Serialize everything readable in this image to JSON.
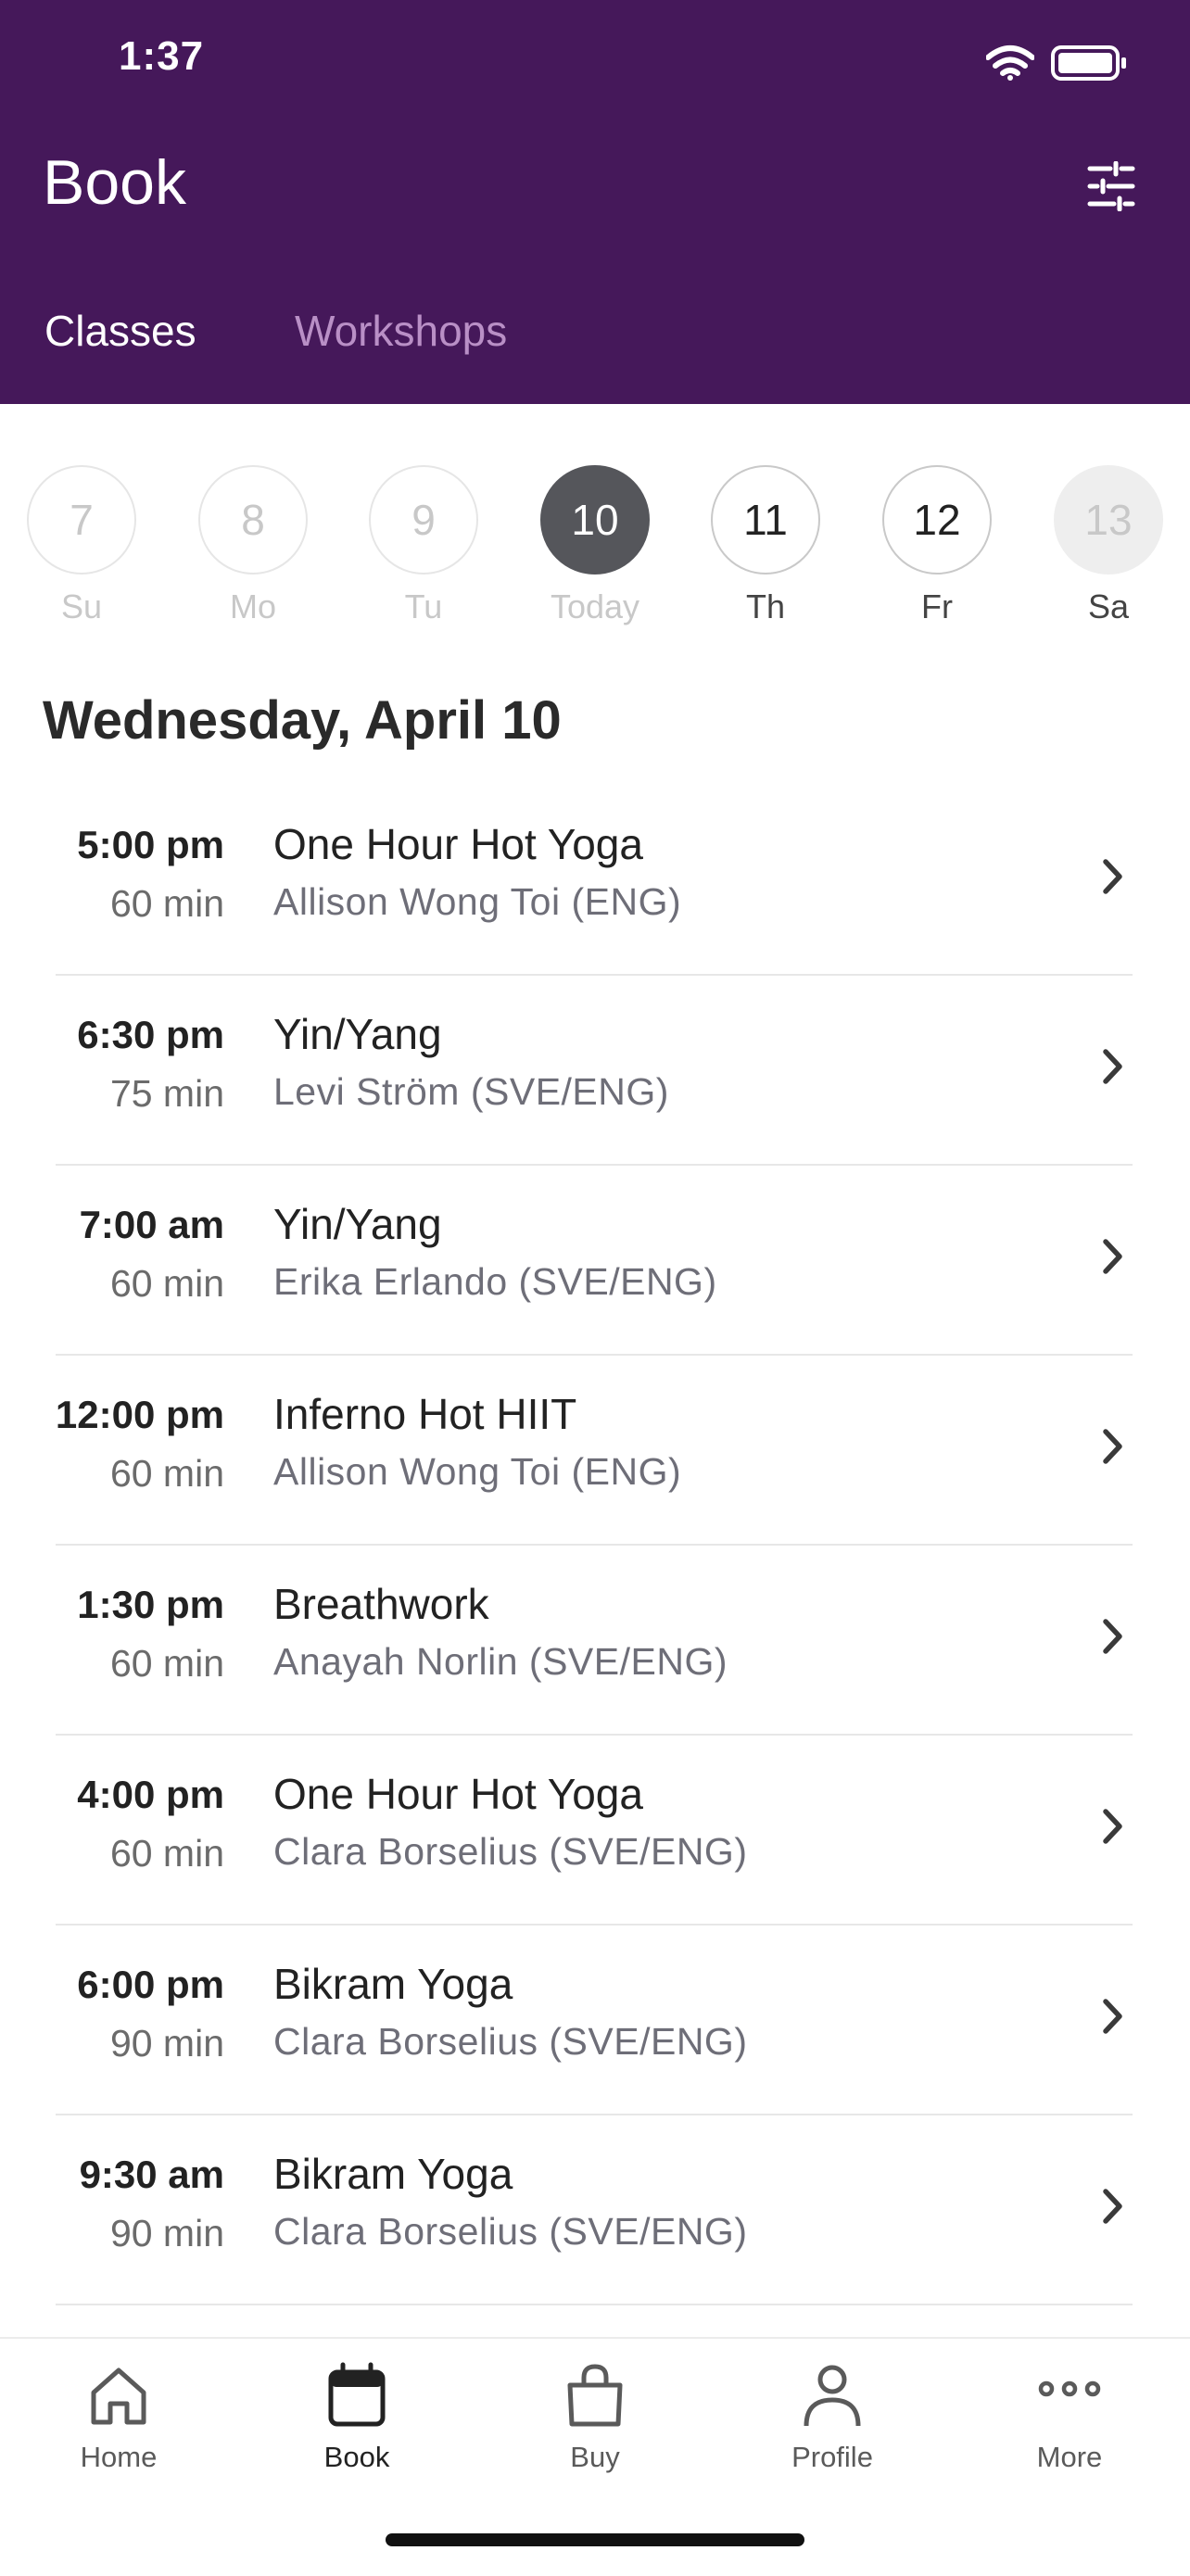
{
  "status_bar": {
    "time": "1:37"
  },
  "header": {
    "title": "Book",
    "filter_icon": "sliders-icon",
    "tabs": [
      {
        "label": "Classes",
        "active": true
      },
      {
        "label": "Workshops",
        "active": false
      }
    ]
  },
  "colors": {
    "header_bg": "#45185a",
    "selected_day": "#55565b",
    "inactive_tab": "#b98fc6"
  },
  "days": [
    {
      "number": "7",
      "label": "Su",
      "state": "past"
    },
    {
      "number": "8",
      "label": "Mo",
      "state": "past"
    },
    {
      "number": "9",
      "label": "Tu",
      "state": "past"
    },
    {
      "number": "10",
      "label": "Today",
      "state": "selected"
    },
    {
      "number": "11",
      "label": "Th",
      "state": "future"
    },
    {
      "number": "12",
      "label": "Fr",
      "state": "future"
    },
    {
      "number": "13",
      "label": "Sa",
      "state": "unavailable"
    }
  ],
  "date_heading": "Wednesday, April 10",
  "classes": [
    {
      "time": "5:00 pm",
      "duration": "60 min",
      "name": "One Hour Hot Yoga",
      "instructor": "Allison Wong Toi (ENG)"
    },
    {
      "time": "6:30 pm",
      "duration": "75 min",
      "name": "Yin/Yang",
      "instructor": "Levi Ström (SVE/ENG)"
    },
    {
      "time": "7:00 am",
      "duration": "60 min",
      "name": "Yin/Yang",
      "instructor": "Erika Erlando (SVE/ENG)"
    },
    {
      "time": "12:00 pm",
      "duration": "60 min",
      "name": "Inferno Hot HIIT",
      "instructor": "Allison Wong Toi (ENG)"
    },
    {
      "time": "1:30 pm",
      "duration": "60 min",
      "name": "Breathwork",
      "instructor": "Anayah Norlin (SVE/ENG)"
    },
    {
      "time": "4:00 pm",
      "duration": "60 min",
      "name": "One Hour Hot Yoga",
      "instructor": "Clara Borselius (SVE/ENG)"
    },
    {
      "time": "6:00 pm",
      "duration": "90 min",
      "name": "Bikram Yoga",
      "instructor": "Clara Borselius (SVE/ENG)"
    },
    {
      "time": "9:30 am",
      "duration": "90 min",
      "name": "Bikram Yoga",
      "instructor": "Clara Borselius (SVE/ENG)"
    }
  ],
  "tabbar": [
    {
      "label": "Home",
      "icon": "home-icon",
      "active": false
    },
    {
      "label": "Book",
      "icon": "calendar-icon",
      "active": true
    },
    {
      "label": "Buy",
      "icon": "shopping-bag-icon",
      "active": false
    },
    {
      "label": "Profile",
      "icon": "person-icon",
      "active": false
    },
    {
      "label": "More",
      "icon": "more-icon",
      "active": false
    }
  ]
}
